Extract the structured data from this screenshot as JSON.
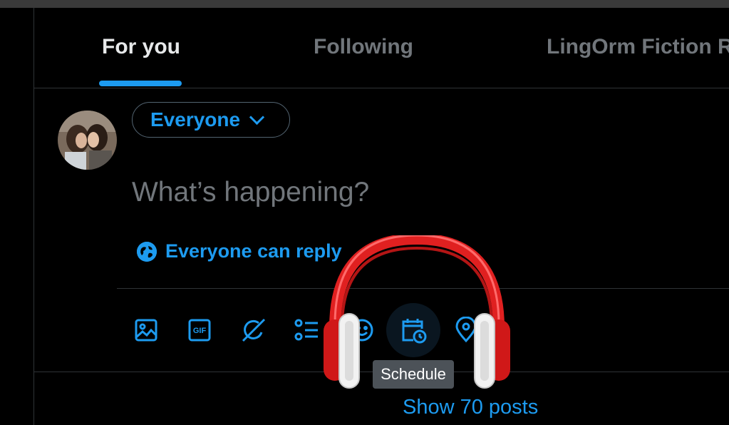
{
  "tabs": [
    {
      "label": "For you",
      "active": true
    },
    {
      "label": "Following",
      "active": false
    },
    {
      "label": "LingOrm Fiction R",
      "active": false
    }
  ],
  "composer": {
    "audience_label": "Everyone",
    "placeholder": "What’s happening?",
    "reply_setting": "Everyone can reply",
    "toolbar": [
      {
        "name": "image-icon"
      },
      {
        "name": "gif-icon",
        "label": "GIF"
      },
      {
        "name": "grok-icon"
      },
      {
        "name": "poll-icon"
      },
      {
        "name": "emoji-icon"
      },
      {
        "name": "schedule-icon",
        "hovered": true
      },
      {
        "name": "location-icon"
      }
    ],
    "tooltip": "Schedule"
  },
  "feed": {
    "show_posts": "Show 70 posts"
  },
  "colors": {
    "accent": "#1d9bf0",
    "background": "#000000",
    "muted_text": "#71767b",
    "border": "#2f3336"
  },
  "overlay": {
    "name": "headphones-sticker",
    "color": "#e02020"
  }
}
